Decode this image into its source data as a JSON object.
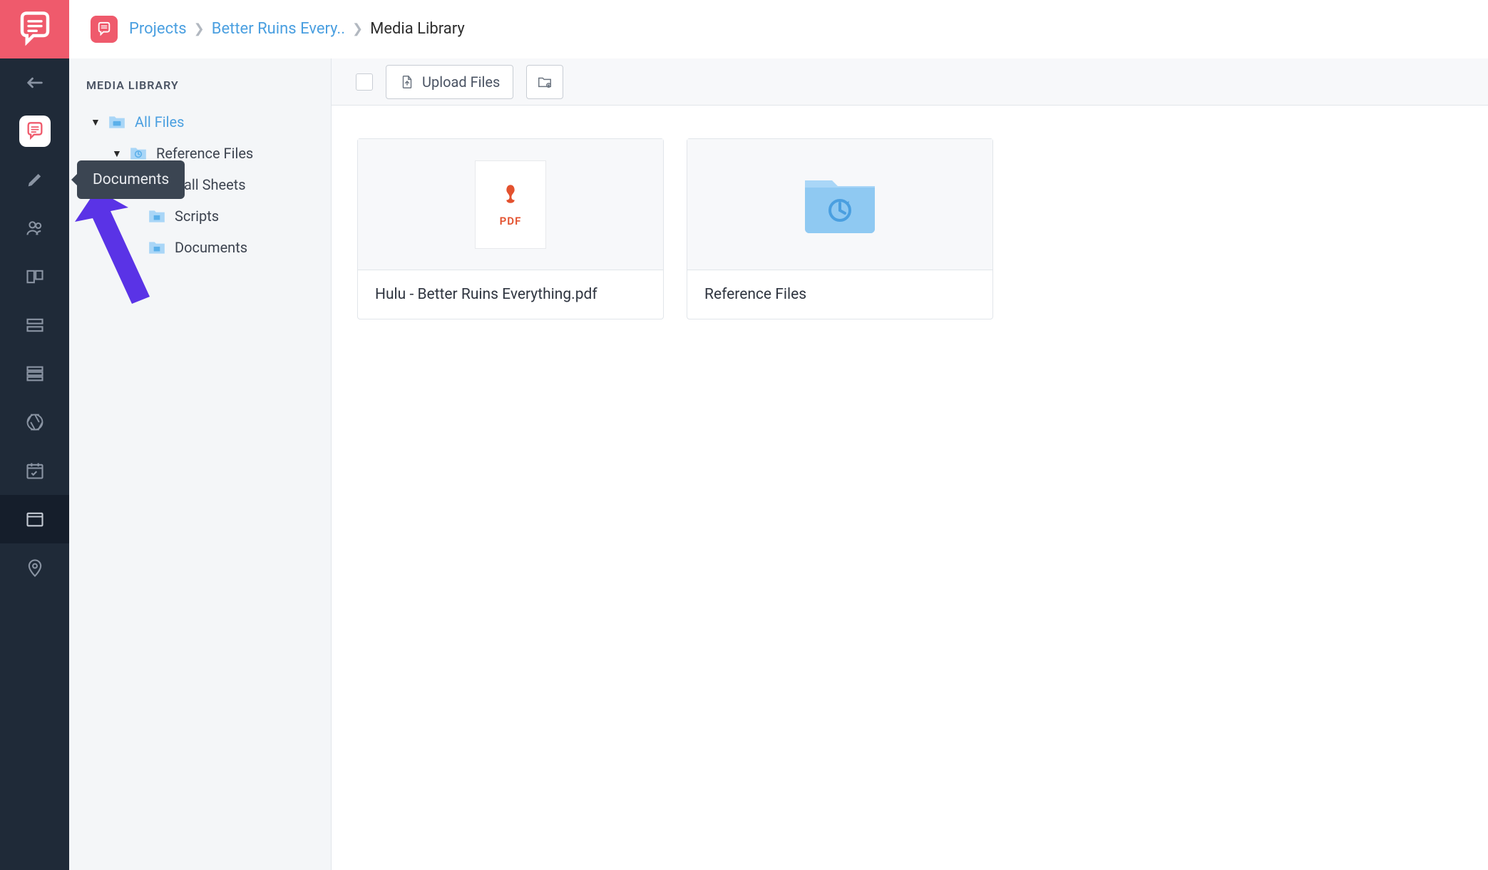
{
  "breadcrumb": {
    "root_label": "Projects",
    "project_label": "Better Ruins Every..",
    "current_label": "Media Library"
  },
  "tree": {
    "title": "MEDIA LIBRARY",
    "all_files": "All Files",
    "reference_files": "Reference Files",
    "call_sheets": "Call Sheets",
    "scripts": "Scripts",
    "documents": "Documents"
  },
  "toolbar": {
    "upload_label": "Upload Files"
  },
  "files": {
    "pdf_name": "Hulu - Better Ruins Everything.pdf",
    "pdf_tag": "PDF",
    "folder_name": "Reference Files"
  },
  "tooltip": {
    "label": "Documents"
  }
}
